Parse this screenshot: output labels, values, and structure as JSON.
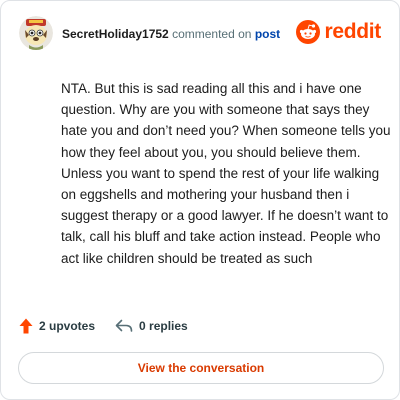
{
  "header": {
    "username": "SecretHoliday1752",
    "action_text": "commented on",
    "post_link": "post",
    "brand_name": "reddit",
    "brand_color": "#ff4500"
  },
  "comment": {
    "text": "NTA. But this is sad reading all this and i have one question. Why are you with someone that says they hate you and don’t need you? When someone tells you how they feel about you, you should believe them. Unless you want to spend the rest of your life walking on eggshells and mothering your husband then i suggest therapy or a good lawyer. If he doesn’t want to talk, call his bluff and take action instead. People who act like children should be treated as such"
  },
  "stats": {
    "upvotes_label": "2 upvotes",
    "replies_label": "0 replies",
    "upvote_icon": "upvote-arrow-icon",
    "reply_icon": "reply-arrow-icon"
  },
  "cta": {
    "label": "View the conversation",
    "color": "#d93a00"
  }
}
